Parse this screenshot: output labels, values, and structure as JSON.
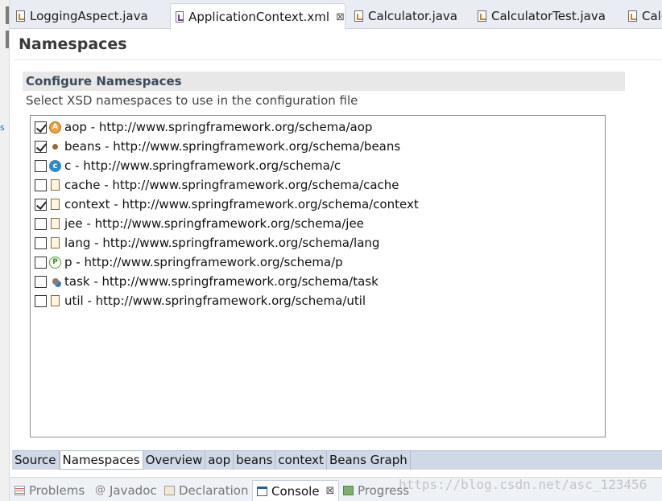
{
  "editor_tabs": [
    {
      "label": "LoggingAspect.java",
      "icon": "java-file-icon",
      "active": false
    },
    {
      "label": "ApplicationContext.xml",
      "icon": "xml-file-icon",
      "active": true,
      "close": "⊠"
    },
    {
      "label": "Calculator.java",
      "icon": "java-file-icon",
      "active": false
    },
    {
      "label": "CalculatorTest.java",
      "icon": "java-file-icon",
      "active": false
    },
    {
      "label": "Calc",
      "icon": "java-file-icon",
      "active": false
    }
  ],
  "page": {
    "title": "Namespaces",
    "section_title": "Configure Namespaces",
    "section_description": "Select XSD namespaces to use in the configuration file"
  },
  "namespaces": [
    {
      "label": "aop - http://www.springframework.org/schema/aop",
      "checked": true,
      "icon": "aop-icon"
    },
    {
      "label": "beans - http://www.springframework.org/schema/beans",
      "checked": true,
      "icon": "beans-icon"
    },
    {
      "label": "c - http://www.springframework.org/schema/c",
      "checked": false,
      "icon": "c-icon"
    },
    {
      "label": "cache - http://www.springframework.org/schema/cache",
      "checked": false,
      "icon": "cache-icon"
    },
    {
      "label": "context - http://www.springframework.org/schema/context",
      "checked": true,
      "icon": "context-icon"
    },
    {
      "label": "jee - http://www.springframework.org/schema/jee",
      "checked": false,
      "icon": "jee-icon"
    },
    {
      "label": "lang - http://www.springframework.org/schema/lang",
      "checked": false,
      "icon": "lang-icon"
    },
    {
      "label": "p - http://www.springframework.org/schema/p",
      "checked": false,
      "icon": "p-icon"
    },
    {
      "label": "task - http://www.springframework.org/schema/task",
      "checked": false,
      "icon": "task-icon"
    },
    {
      "label": "util - http://www.springframework.org/schema/util",
      "checked": false,
      "icon": "util-icon"
    }
  ],
  "bottom_tabs": [
    {
      "label": "Source",
      "active": false
    },
    {
      "label": "Namespaces",
      "active": true
    },
    {
      "label": "Overview",
      "active": false
    },
    {
      "label": "aop",
      "active": false
    },
    {
      "label": "beans",
      "active": false
    },
    {
      "label": "context",
      "active": false
    },
    {
      "label": "Beans Graph",
      "active": false
    }
  ],
  "view_tabs": [
    {
      "label": "Problems",
      "icon": "problems-icon",
      "active": false
    },
    {
      "label": "Javadoc",
      "icon": "javadoc-icon",
      "active": false
    },
    {
      "label": "Declaration",
      "icon": "declaration-icon",
      "active": false
    },
    {
      "label": "Console",
      "icon": "console-icon",
      "active": true,
      "close": "⊠"
    },
    {
      "label": "Progress",
      "icon": "progress-icon",
      "active": false
    }
  ],
  "watermark": "https://blog.csdn.net/asc_123456",
  "gutter_mark": "s"
}
